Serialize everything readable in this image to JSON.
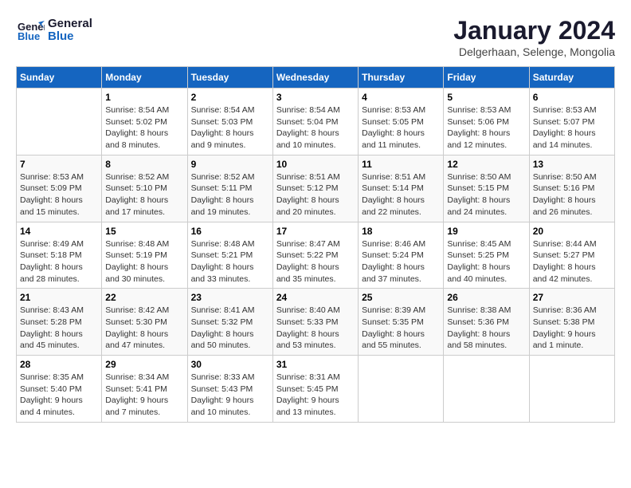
{
  "header": {
    "logo_line1": "General",
    "logo_line2": "Blue",
    "month_title": "January 2024",
    "location": "Delgerhaan, Selenge, Mongolia"
  },
  "days_of_week": [
    "Sunday",
    "Monday",
    "Tuesday",
    "Wednesday",
    "Thursday",
    "Friday",
    "Saturday"
  ],
  "weeks": [
    [
      {
        "day": "",
        "sunrise": "",
        "sunset": "",
        "daylight": ""
      },
      {
        "day": "1",
        "sunrise": "Sunrise: 8:54 AM",
        "sunset": "Sunset: 5:02 PM",
        "daylight": "Daylight: 8 hours and 8 minutes."
      },
      {
        "day": "2",
        "sunrise": "Sunrise: 8:54 AM",
        "sunset": "Sunset: 5:03 PM",
        "daylight": "Daylight: 8 hours and 9 minutes."
      },
      {
        "day": "3",
        "sunrise": "Sunrise: 8:54 AM",
        "sunset": "Sunset: 5:04 PM",
        "daylight": "Daylight: 8 hours and 10 minutes."
      },
      {
        "day": "4",
        "sunrise": "Sunrise: 8:53 AM",
        "sunset": "Sunset: 5:05 PM",
        "daylight": "Daylight: 8 hours and 11 minutes."
      },
      {
        "day": "5",
        "sunrise": "Sunrise: 8:53 AM",
        "sunset": "Sunset: 5:06 PM",
        "daylight": "Daylight: 8 hours and 12 minutes."
      },
      {
        "day": "6",
        "sunrise": "Sunrise: 8:53 AM",
        "sunset": "Sunset: 5:07 PM",
        "daylight": "Daylight: 8 hours and 14 minutes."
      }
    ],
    [
      {
        "day": "7",
        "sunrise": "Sunrise: 8:53 AM",
        "sunset": "Sunset: 5:09 PM",
        "daylight": "Daylight: 8 hours and 15 minutes."
      },
      {
        "day": "8",
        "sunrise": "Sunrise: 8:52 AM",
        "sunset": "Sunset: 5:10 PM",
        "daylight": "Daylight: 8 hours and 17 minutes."
      },
      {
        "day": "9",
        "sunrise": "Sunrise: 8:52 AM",
        "sunset": "Sunset: 5:11 PM",
        "daylight": "Daylight: 8 hours and 19 minutes."
      },
      {
        "day": "10",
        "sunrise": "Sunrise: 8:51 AM",
        "sunset": "Sunset: 5:12 PM",
        "daylight": "Daylight: 8 hours and 20 minutes."
      },
      {
        "day": "11",
        "sunrise": "Sunrise: 8:51 AM",
        "sunset": "Sunset: 5:14 PM",
        "daylight": "Daylight: 8 hours and 22 minutes."
      },
      {
        "day": "12",
        "sunrise": "Sunrise: 8:50 AM",
        "sunset": "Sunset: 5:15 PM",
        "daylight": "Daylight: 8 hours and 24 minutes."
      },
      {
        "day": "13",
        "sunrise": "Sunrise: 8:50 AM",
        "sunset": "Sunset: 5:16 PM",
        "daylight": "Daylight: 8 hours and 26 minutes."
      }
    ],
    [
      {
        "day": "14",
        "sunrise": "Sunrise: 8:49 AM",
        "sunset": "Sunset: 5:18 PM",
        "daylight": "Daylight: 8 hours and 28 minutes."
      },
      {
        "day": "15",
        "sunrise": "Sunrise: 8:48 AM",
        "sunset": "Sunset: 5:19 PM",
        "daylight": "Daylight: 8 hours and 30 minutes."
      },
      {
        "day": "16",
        "sunrise": "Sunrise: 8:48 AM",
        "sunset": "Sunset: 5:21 PM",
        "daylight": "Daylight: 8 hours and 33 minutes."
      },
      {
        "day": "17",
        "sunrise": "Sunrise: 8:47 AM",
        "sunset": "Sunset: 5:22 PM",
        "daylight": "Daylight: 8 hours and 35 minutes."
      },
      {
        "day": "18",
        "sunrise": "Sunrise: 8:46 AM",
        "sunset": "Sunset: 5:24 PM",
        "daylight": "Daylight: 8 hours and 37 minutes."
      },
      {
        "day": "19",
        "sunrise": "Sunrise: 8:45 AM",
        "sunset": "Sunset: 5:25 PM",
        "daylight": "Daylight: 8 hours and 40 minutes."
      },
      {
        "day": "20",
        "sunrise": "Sunrise: 8:44 AM",
        "sunset": "Sunset: 5:27 PM",
        "daylight": "Daylight: 8 hours and 42 minutes."
      }
    ],
    [
      {
        "day": "21",
        "sunrise": "Sunrise: 8:43 AM",
        "sunset": "Sunset: 5:28 PM",
        "daylight": "Daylight: 8 hours and 45 minutes."
      },
      {
        "day": "22",
        "sunrise": "Sunrise: 8:42 AM",
        "sunset": "Sunset: 5:30 PM",
        "daylight": "Daylight: 8 hours and 47 minutes."
      },
      {
        "day": "23",
        "sunrise": "Sunrise: 8:41 AM",
        "sunset": "Sunset: 5:32 PM",
        "daylight": "Daylight: 8 hours and 50 minutes."
      },
      {
        "day": "24",
        "sunrise": "Sunrise: 8:40 AM",
        "sunset": "Sunset: 5:33 PM",
        "daylight": "Daylight: 8 hours and 53 minutes."
      },
      {
        "day": "25",
        "sunrise": "Sunrise: 8:39 AM",
        "sunset": "Sunset: 5:35 PM",
        "daylight": "Daylight: 8 hours and 55 minutes."
      },
      {
        "day": "26",
        "sunrise": "Sunrise: 8:38 AM",
        "sunset": "Sunset: 5:36 PM",
        "daylight": "Daylight: 8 hours and 58 minutes."
      },
      {
        "day": "27",
        "sunrise": "Sunrise: 8:36 AM",
        "sunset": "Sunset: 5:38 PM",
        "daylight": "Daylight: 9 hours and 1 minute."
      }
    ],
    [
      {
        "day": "28",
        "sunrise": "Sunrise: 8:35 AM",
        "sunset": "Sunset: 5:40 PM",
        "daylight": "Daylight: 9 hours and 4 minutes."
      },
      {
        "day": "29",
        "sunrise": "Sunrise: 8:34 AM",
        "sunset": "Sunset: 5:41 PM",
        "daylight": "Daylight: 9 hours and 7 minutes."
      },
      {
        "day": "30",
        "sunrise": "Sunrise: 8:33 AM",
        "sunset": "Sunset: 5:43 PM",
        "daylight": "Daylight: 9 hours and 10 minutes."
      },
      {
        "day": "31",
        "sunrise": "Sunrise: 8:31 AM",
        "sunset": "Sunset: 5:45 PM",
        "daylight": "Daylight: 9 hours and 13 minutes."
      },
      {
        "day": "",
        "sunrise": "",
        "sunset": "",
        "daylight": ""
      },
      {
        "day": "",
        "sunrise": "",
        "sunset": "",
        "daylight": ""
      },
      {
        "day": "",
        "sunrise": "",
        "sunset": "",
        "daylight": ""
      }
    ]
  ]
}
